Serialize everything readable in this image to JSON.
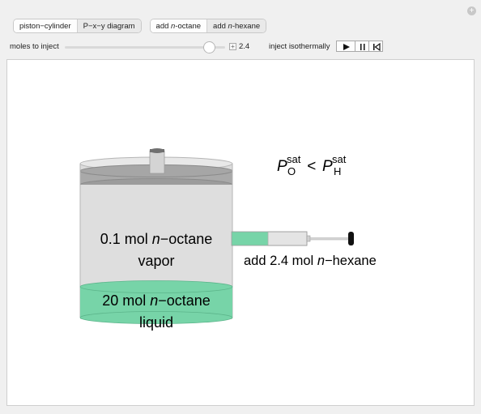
{
  "controls": {
    "view_tabs": [
      {
        "label": "piston−cylinder",
        "selected": false
      },
      {
        "label": "P−x−y diagram",
        "selected": true
      }
    ],
    "add_tabs": [
      {
        "prefix": "add ",
        "italic": "n",
        "suffix": "-octane",
        "selected": false
      },
      {
        "prefix": "add ",
        "italic": "n",
        "suffix": "-hexane",
        "selected": true
      }
    ],
    "moles_label": "moles to inject",
    "moles_value": "2.4",
    "moles_fraction": 0.9,
    "inject_label": "inject isothermally"
  },
  "scene": {
    "vapor": {
      "line1_pre": "0.1 mol ",
      "line1_it": "n",
      "line1_post": "−octane",
      "line2": "vapor"
    },
    "liquid": {
      "line1_pre": "20 mol ",
      "line1_it": "n",
      "line1_post": "−octane",
      "line2": "liquid"
    },
    "syringe_label": {
      "pre": "add 2.4 mol ",
      "it": "n",
      "post": "−hexane"
    },
    "inequality": {
      "p": "P",
      "sup": "sat",
      "sub_left": "O",
      "op": " < ",
      "sub_right": "H"
    },
    "colors": {
      "liquid": "#77d4a8",
      "cylinder": "#d9d9d9",
      "piston": "#a3a3a3"
    }
  }
}
